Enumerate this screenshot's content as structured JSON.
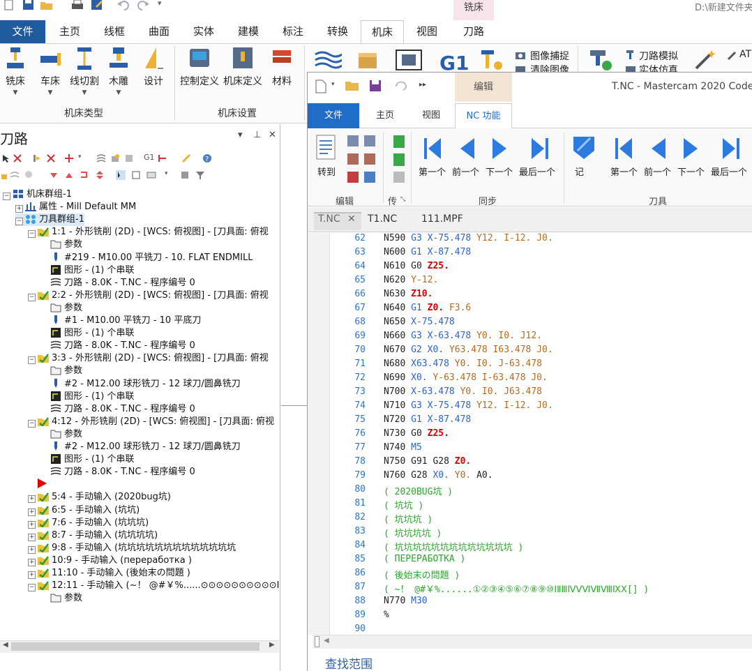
{
  "window": {
    "context_tab": "铣床",
    "file_path": "D:\\新建文件夹"
  },
  "ribbon_tabs": [
    "文件",
    "主页",
    "线框",
    "曲面",
    "实体",
    "建模",
    "标注",
    "转换",
    "机床",
    "视图",
    "刀路"
  ],
  "ribbon": {
    "machine_type_buttons": [
      "铣床",
      "车床",
      "线切割",
      "木雕",
      "设计"
    ],
    "machine_type_group": "机床类型",
    "machine_setup_buttons": [
      "控制定义",
      "机床定义",
      "材料"
    ],
    "machine_setup_group": "机床设置",
    "right_items": {
      "image_capture": "图像捕捉",
      "clear_image": "清除图像",
      "toolpath_sim": "刀路模拟",
      "solid_sim": "实体仿真",
      "g1_label": "G1",
      "at_label": "AT"
    }
  },
  "left_panel": {
    "title": "刀路",
    "controls": [
      "▾",
      "⊥",
      "✕"
    ],
    "tree": [
      {
        "level": 0,
        "exp": "−",
        "icon": "machine-group-icon",
        "text": "机床群组-1"
      },
      {
        "level": 1,
        "exp": "+",
        "icon": "properties-icon",
        "text": "属性 - Mill Default MM"
      },
      {
        "level": 1,
        "exp": "−",
        "icon": "toolgroup-icon",
        "text": "刀具群组-1",
        "selected": true
      },
      {
        "level": 2,
        "exp": "−",
        "icon": "operation-icon",
        "text": "1:1 - 外形铣削 (2D) - [WCS: 俯视图] - [刀具面: 俯视"
      },
      {
        "level": 3,
        "exp": "",
        "icon": "params-icon",
        "text": "参数"
      },
      {
        "level": 3,
        "exp": "",
        "icon": "tool-icon",
        "text": "#219 - M10.00 平铣刀 -     10. FLAT ENDMILL"
      },
      {
        "level": 3,
        "exp": "",
        "icon": "geometry-icon",
        "text": "图形 - (1) 个串联"
      },
      {
        "level": 3,
        "exp": "",
        "icon": "toolpath-icon",
        "text": "刀路 - 8.0K - T.NC - 程序编号 0"
      },
      {
        "level": 2,
        "exp": "−",
        "icon": "operation-icon",
        "text": "2:2 - 外形铣削 (2D) - [WCS: 俯视图] - [刀具面: 俯视"
      },
      {
        "level": 3,
        "exp": "",
        "icon": "params-icon",
        "text": "参数"
      },
      {
        "level": 3,
        "exp": "",
        "icon": "tool-icon",
        "text": "#1 - M10.00 平铣刀 - 10 平底刀"
      },
      {
        "level": 3,
        "exp": "",
        "icon": "geometry-icon",
        "text": "图形 - (1) 个串联"
      },
      {
        "level": 3,
        "exp": "",
        "icon": "toolpath-icon",
        "text": "刀路 - 8.0K - T.NC - 程序编号 0"
      },
      {
        "level": 2,
        "exp": "−",
        "icon": "operation-icon",
        "text": "3:3 - 外形铣削 (2D) - [WCS: 俯视图] - [刀具面: 俯视"
      },
      {
        "level": 3,
        "exp": "",
        "icon": "params-icon",
        "text": "参数"
      },
      {
        "level": 3,
        "exp": "",
        "icon": "tool-icon",
        "text": "#2 - M12.00 球形铣刀 - 12 球刀/圆鼻铣刀"
      },
      {
        "level": 3,
        "exp": "",
        "icon": "geometry-icon",
        "text": "图形 - (1) 个串联"
      },
      {
        "level": 3,
        "exp": "",
        "icon": "toolpath-icon",
        "text": "刀路 - 8.0K - T.NC - 程序编号 0"
      },
      {
        "level": 2,
        "exp": "−",
        "icon": "operation-icon",
        "text": "4:12 - 外形铣削 (2D) - [WCS: 俯视图] - [刀具面: 俯视"
      },
      {
        "level": 3,
        "exp": "",
        "icon": "params-icon",
        "text": "参数"
      },
      {
        "level": 3,
        "exp": "",
        "icon": "tool-icon",
        "text": "#2 - M12.00 球形铣刀 - 12 球刀/圆鼻铣刀"
      },
      {
        "level": 3,
        "exp": "",
        "icon": "geometry-icon",
        "text": "图形 - (1) 个串联"
      },
      {
        "level": 3,
        "exp": "",
        "icon": "toolpath-icon",
        "text": "刀路 - 8.0K - T.NC - 程序编号 0"
      },
      {
        "level": 2,
        "exp": "",
        "icon": "insert-arrow-icon",
        "text": ""
      },
      {
        "level": 2,
        "exp": "+",
        "icon": "operation-icon",
        "text": "5:4 - 手动输入 (2020bug坑)"
      },
      {
        "level": 2,
        "exp": "+",
        "icon": "operation-icon",
        "text": "6:5 - 手动输入 (坑坑)"
      },
      {
        "level": 2,
        "exp": "+",
        "icon": "operation-icon",
        "text": "7:6 - 手动输入 (坑坑坑)"
      },
      {
        "level": 2,
        "exp": "+",
        "icon": "operation-icon",
        "text": "8:7 - 手动输入 (坑坑坑坑)"
      },
      {
        "level": 2,
        "exp": "+",
        "icon": "operation-icon",
        "text": "9:8 - 手动输入 (坑坑坑坑坑坑坑坑坑坑坑坑坑"
      },
      {
        "level": 2,
        "exp": "+",
        "icon": "operation-icon",
        "text": "10:9 - 手动输入 (переработка )"
      },
      {
        "level": 2,
        "exp": "+",
        "icon": "operation-icon",
        "text": "11:10 - 手动输入 (後始末の問題 )"
      },
      {
        "level": 2,
        "exp": "−",
        "icon": "operation-icon",
        "text": "12:11 - 手动输入 (~！ @#￥%......⊙⊙⊙⊙⊙⊙⊙⊙⊙⊙ⅠⅡⅢⅣ"
      },
      {
        "level": 3,
        "exp": "",
        "icon": "params-icon",
        "text": "参数"
      }
    ]
  },
  "code_expert": {
    "context_tab": "编辑",
    "title": "T.NC - Mastercam 2020 Code E",
    "tabs": [
      "文件",
      "主页",
      "视图",
      "NC 功能"
    ],
    "buttons": {
      "goto": "转到",
      "first": "第一个",
      "prev": "前一个",
      "next": "下一个",
      "last": "最后一个",
      "mark": "记"
    },
    "groups": {
      "edit": "编辑",
      "transfer": "传",
      "sync": "同步",
      "tool": "刀具"
    },
    "doc_tabs": [
      "T.NC",
      "T1.NC",
      "111.MPF"
    ],
    "doc_tab_close": "✕",
    "find_label": "查找范围",
    "lines": [
      {
        "n": "62",
        "t": [
          [
            "N590 ",
            "n"
          ],
          [
            "G3 ",
            "g"
          ],
          [
            "X-75.478 ",
            "g"
          ],
          [
            "Y12. ",
            "o"
          ],
          [
            "I-12. ",
            "o"
          ],
          [
            "J0.",
            "o"
          ]
        ]
      },
      {
        "n": "63",
        "t": [
          [
            "N600 ",
            "n"
          ],
          [
            "G1 ",
            "g"
          ],
          [
            "X-87.478",
            "g"
          ]
        ]
      },
      {
        "n": "64",
        "t": [
          [
            "N610 ",
            "n"
          ],
          [
            "G0 ",
            "n"
          ],
          [
            "Z25.",
            "r"
          ]
        ]
      },
      {
        "n": "65",
        "t": [
          [
            "N620 ",
            "n"
          ],
          [
            "Y-12.",
            "o"
          ]
        ]
      },
      {
        "n": "66",
        "t": [
          [
            "N630 ",
            "n"
          ],
          [
            "Z10.",
            "r"
          ]
        ]
      },
      {
        "n": "67",
        "t": [
          [
            "N640 ",
            "n"
          ],
          [
            "G1 ",
            "g"
          ],
          [
            "Z0. ",
            "r"
          ],
          [
            "F3.6",
            "o"
          ]
        ]
      },
      {
        "n": "68",
        "t": [
          [
            "N650 ",
            "n"
          ],
          [
            "X-75.478",
            "g"
          ]
        ]
      },
      {
        "n": "69",
        "t": [
          [
            "N660 ",
            "n"
          ],
          [
            "G3 ",
            "g"
          ],
          [
            "X-63.478 ",
            "g"
          ],
          [
            "Y0. ",
            "o"
          ],
          [
            "I0. ",
            "o"
          ],
          [
            "J12.",
            "o"
          ]
        ]
      },
      {
        "n": "70",
        "t": [
          [
            "N670 ",
            "n"
          ],
          [
            "G2 ",
            "g"
          ],
          [
            "X0. ",
            "g"
          ],
          [
            "Y63.478 ",
            "o"
          ],
          [
            "I63.478 ",
            "o"
          ],
          [
            "J0.",
            "o"
          ]
        ]
      },
      {
        "n": "71",
        "t": [
          [
            "N680 ",
            "n"
          ],
          [
            "X63.478 ",
            "g"
          ],
          [
            "Y0. ",
            "o"
          ],
          [
            "I0. ",
            "o"
          ],
          [
            "J-63.478",
            "o"
          ]
        ]
      },
      {
        "n": "72",
        "t": [
          [
            "N690 ",
            "n"
          ],
          [
            "X0. ",
            "g"
          ],
          [
            "Y-63.478 ",
            "o"
          ],
          [
            "I-63.478 ",
            "o"
          ],
          [
            "J0.",
            "o"
          ]
        ]
      },
      {
        "n": "73",
        "t": [
          [
            "N700 ",
            "n"
          ],
          [
            "X-63.478 ",
            "g"
          ],
          [
            "Y0. ",
            "o"
          ],
          [
            "I0. ",
            "o"
          ],
          [
            "J63.478",
            "o"
          ]
        ]
      },
      {
        "n": "74",
        "t": [
          [
            "N710 ",
            "n"
          ],
          [
            "G3 ",
            "g"
          ],
          [
            "X-75.478 ",
            "g"
          ],
          [
            "Y12. ",
            "o"
          ],
          [
            "I-12. ",
            "o"
          ],
          [
            "J0.",
            "o"
          ]
        ]
      },
      {
        "n": "75",
        "t": [
          [
            "N720 ",
            "n"
          ],
          [
            "G1 ",
            "g"
          ],
          [
            "X-87.478",
            "g"
          ]
        ]
      },
      {
        "n": "76",
        "t": [
          [
            "N730 ",
            "n"
          ],
          [
            "G0 ",
            "n"
          ],
          [
            "Z25.",
            "r"
          ]
        ]
      },
      {
        "n": "77",
        "t": [
          [
            "N740 ",
            "n"
          ],
          [
            "M5",
            "g"
          ]
        ]
      },
      {
        "n": "78",
        "t": [
          [
            "N750 ",
            "n"
          ],
          [
            "G91 ",
            "n"
          ],
          [
            "G28 ",
            "n"
          ],
          [
            "Z0.",
            "r"
          ]
        ]
      },
      {
        "n": "79",
        "t": [
          [
            "N760 ",
            "n"
          ],
          [
            "G28 ",
            "n"
          ],
          [
            "X0. ",
            "g"
          ],
          [
            "Y0. ",
            "o"
          ],
          [
            "A0.",
            "n"
          ]
        ]
      },
      {
        "n": "80",
        "t": [
          [
            "( 2020BUG坑 )",
            "c"
          ]
        ]
      },
      {
        "n": "81",
        "t": [
          [
            "( 坑坑 )",
            "c"
          ]
        ]
      },
      {
        "n": "82",
        "t": [
          [
            "( 坑坑坑 )",
            "c"
          ]
        ]
      },
      {
        "n": "83",
        "t": [
          [
            "( 坑坑坑坑 )",
            "c"
          ]
        ]
      },
      {
        "n": "84",
        "t": [
          [
            "( 坑坑坑坑坑坑坑坑坑坑坑坑坑 )",
            "c"
          ]
        ]
      },
      {
        "n": "85",
        "t": [
          [
            "( ПЕРЕРАБОТКА )",
            "c"
          ]
        ]
      },
      {
        "n": "86",
        "t": [
          [
            "( 後始末の問題 )",
            "c"
          ]
        ]
      },
      {
        "n": "87",
        "t": [
          [
            "( ~！ @#￥%......①②③④⑤⑥⑦⑧⑨⑩ⅠⅡⅢⅣⅤⅥⅦⅧⅨⅩ[] )",
            "c"
          ]
        ]
      },
      {
        "n": "88",
        "t": [
          [
            "N770 ",
            "n"
          ],
          [
            "M30",
            "g"
          ]
        ]
      },
      {
        "n": "89",
        "t": [
          [
            "%",
            "n"
          ]
        ]
      },
      {
        "n": "90",
        "t": []
      }
    ]
  },
  "colors": {
    "file_tab": "#1f5a9e",
    "code_g": "#2a62d1",
    "code_comment": "#2aa52a",
    "code_z": "#d40000",
    "line_number": "#2b74c7"
  }
}
